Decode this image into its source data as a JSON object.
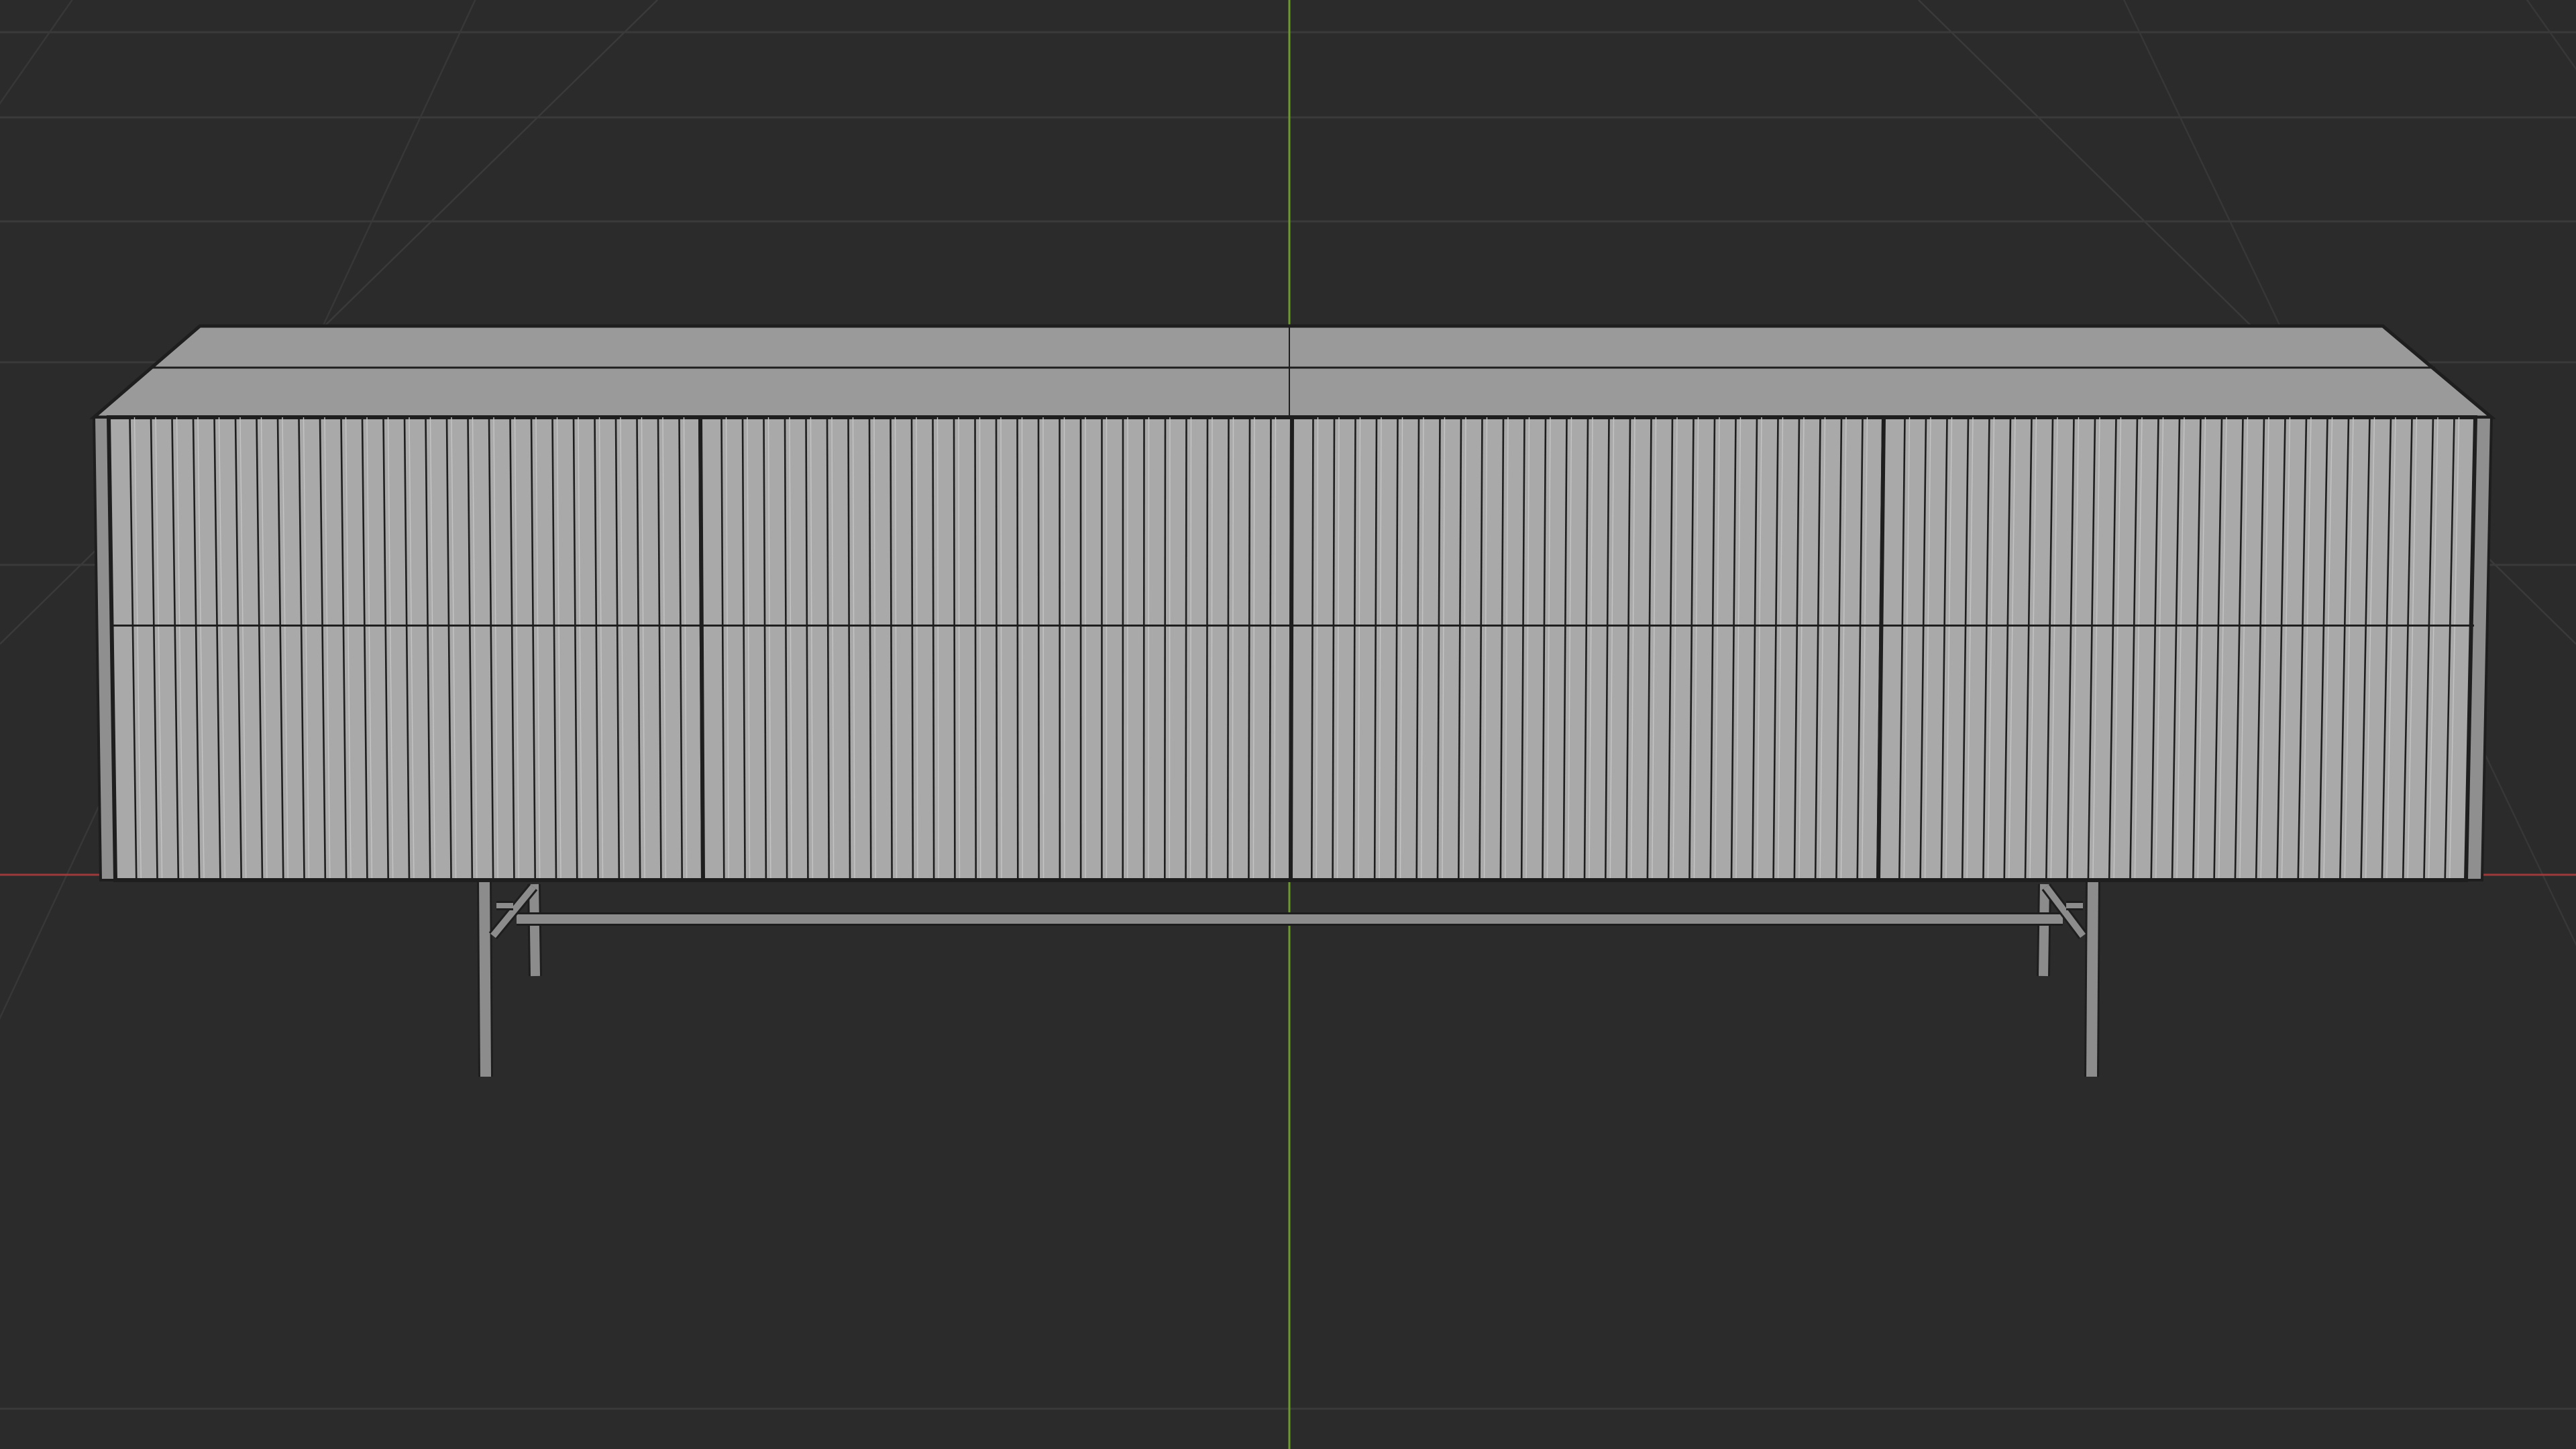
{
  "app": {
    "name": "",
    "view": "3D viewport"
  },
  "viewport": {
    "background": "#2b2b2b",
    "grid_color": "#3a3a3a",
    "grid_line_color_light": "#444444",
    "x_axis_color": "#9c3a3a",
    "y_axis_color": "#6d9a2e",
    "shading": "solid",
    "overlay": "wireframe",
    "text_labels": []
  },
  "scene": {
    "object": {
      "kind": "sideboard",
      "door_panels": 4,
      "drawer_rows": 2,
      "slats_per_panel": 28,
      "legs": 4,
      "surface_color": "#a9a9a9",
      "top_color": "#9a9a9a",
      "edge_color": "#1e1e1e",
      "metal_color": "#8c8c8c"
    }
  }
}
